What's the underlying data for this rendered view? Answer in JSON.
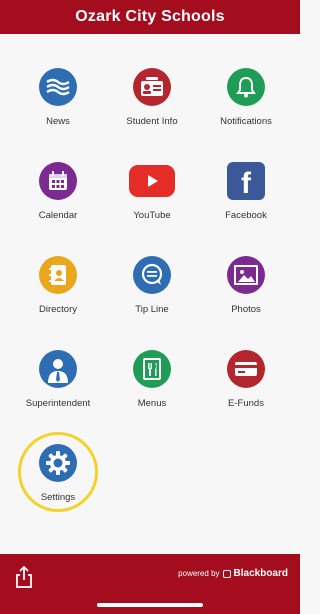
{
  "header": {
    "title": "Ozark City Schools"
  },
  "tiles": [
    {
      "label": "News",
      "color": "#2f6db3"
    },
    {
      "label": "Student Info",
      "color": "#b3262d"
    },
    {
      "label": "Notifications",
      "color": "#1f9d57"
    },
    {
      "label": "Calendar",
      "color": "#7b2a91"
    },
    {
      "label": "YouTube",
      "color": "#e52d27"
    },
    {
      "label": "Facebook",
      "color": "#3b5998"
    },
    {
      "label": "Directory",
      "color": "#e9a71b"
    },
    {
      "label": "Tip Line",
      "color": "#2f6db3"
    },
    {
      "label": "Photos",
      "color": "#7b2a91"
    },
    {
      "label": "Superintendent",
      "color": "#2f6db3"
    },
    {
      "label": "Menus",
      "color": "#1f9d57"
    },
    {
      "label": "E-Funds",
      "color": "#b3262d"
    },
    {
      "label": "Settings",
      "color": "#2f6db3"
    }
  ],
  "footer": {
    "powered_by": "powered by",
    "brand": "Blackboard"
  }
}
